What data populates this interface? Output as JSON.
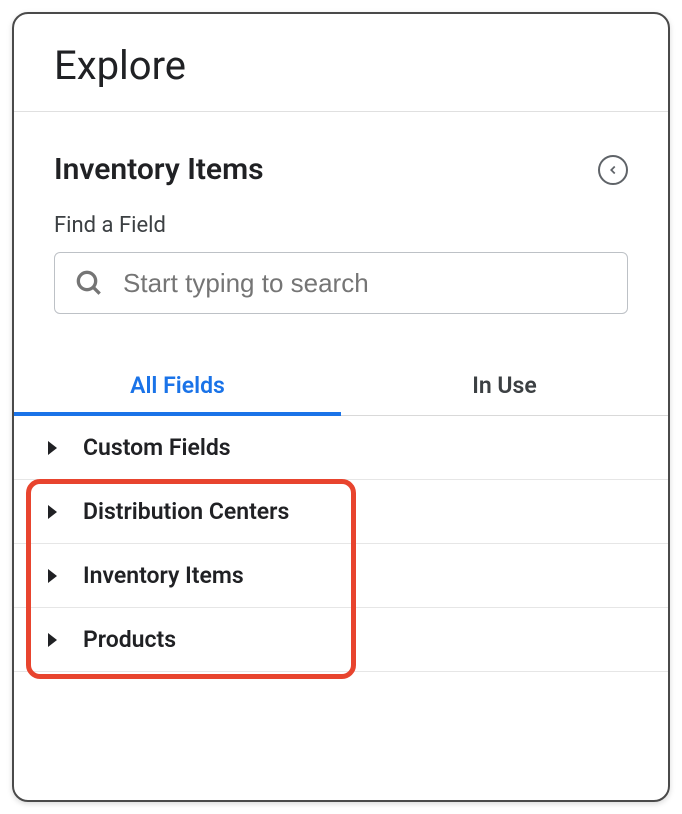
{
  "header": {
    "title": "Explore"
  },
  "section": {
    "title": "Inventory Items"
  },
  "search": {
    "label": "Find a Field",
    "placeholder": "Start typing to search"
  },
  "tabs": {
    "all_fields": "All Fields",
    "in_use": "In Use"
  },
  "fields": {
    "custom_fields": "Custom Fields",
    "distribution_centers": "Distribution Centers",
    "inventory_items": "Inventory Items",
    "products": "Products"
  }
}
